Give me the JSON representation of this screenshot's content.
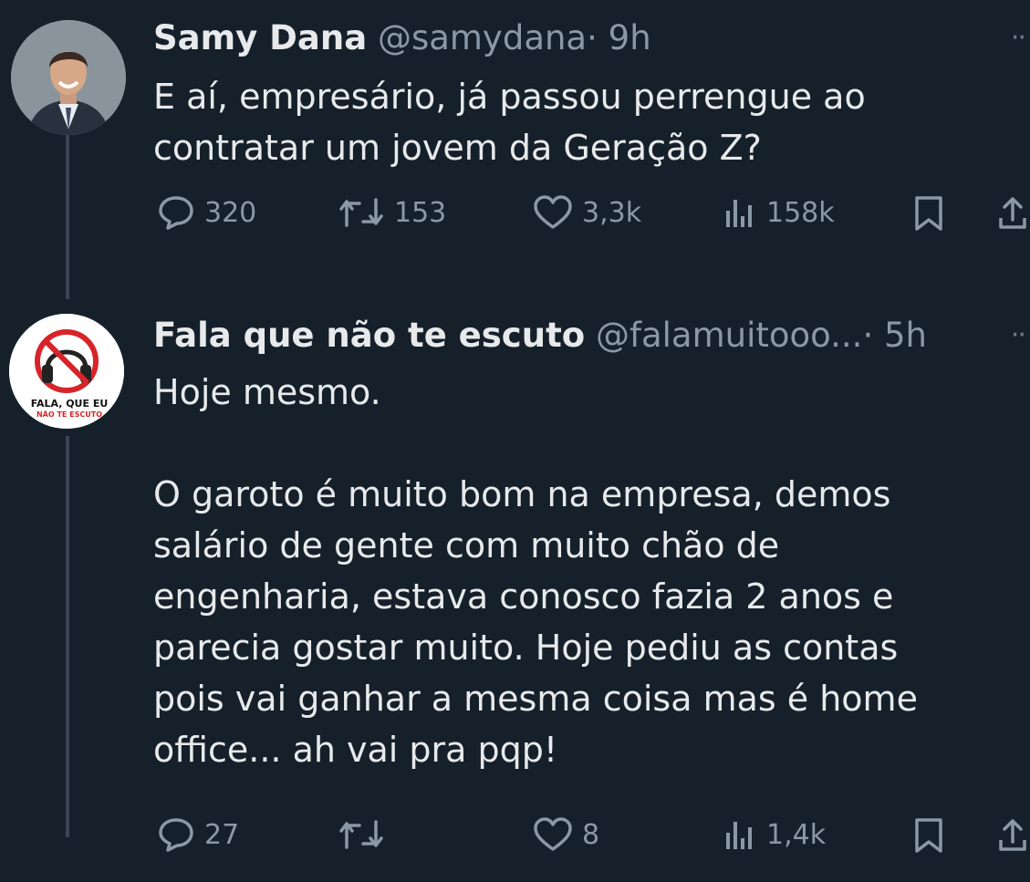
{
  "tweets": [
    {
      "name": "Samy Dana",
      "handle": "@samydana",
      "time": "· 9h",
      "text": "E aí, empresário, já passou perrengue ao\ncontratar um jovem da Geração Z?",
      "replies": "320",
      "retweets": "153",
      "likes": "3,3k",
      "views": "158k"
    },
    {
      "name": "Fala que não te escuto",
      "handle": "@falamuitooo...",
      "time": "· 5h",
      "text": "Hoje mesmo.\n\nO garoto é muito bom na empresa, demos\nsalário de gente com muito chão de\nengenharia, estava conosco fazia 2 anos e\nparecia gostar muito. Hoje pediu as contas\npois vai ganhar a mesma coisa mas é home\noffice... ah vai pra pqp!",
      "replies": "27",
      "retweets": "",
      "likes": "8",
      "views": "1,4k",
      "avatar_text_1": "FALA, QUE EU",
      "avatar_text_2": "NÃO TE ESCUTO"
    }
  ],
  "more_icon": "··",
  "colors": {
    "background": "#15202b",
    "text": "#e7e9ea",
    "muted": "#8b98a5",
    "logo_red": "#d7242a"
  }
}
